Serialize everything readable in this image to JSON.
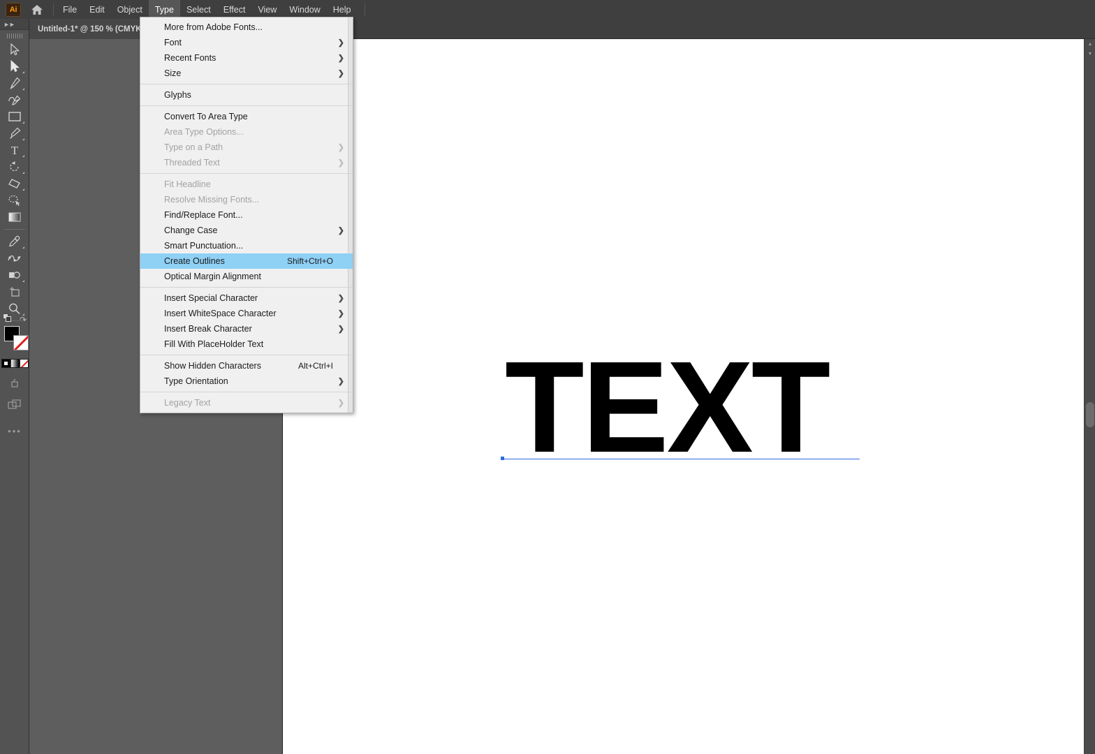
{
  "app": {
    "name": "Adobe Illustrator",
    "logo_text": "Ai",
    "home_icon": "home-icon"
  },
  "menubar": {
    "items": [
      {
        "label": "File",
        "active": false
      },
      {
        "label": "Edit",
        "active": false
      },
      {
        "label": "Object",
        "active": false
      },
      {
        "label": "Type",
        "active": true
      },
      {
        "label": "Select",
        "active": false
      },
      {
        "label": "Effect",
        "active": false
      },
      {
        "label": "View",
        "active": false
      },
      {
        "label": "Window",
        "active": false
      },
      {
        "label": "Help",
        "active": false
      }
    ]
  },
  "document": {
    "tab_label": "Untitled-1* @ 150 % (CMYK/",
    "zoom": "150 %",
    "color_mode": "CMYK",
    "modified": true
  },
  "toolbar": {
    "collapse_icon": "double-chevron-right-icon",
    "grip_icon": "panel-grip-icon",
    "tools": [
      {
        "name": "selection-tool",
        "icon": "arrow-cursor-icon",
        "selected": false,
        "has_flyout": false
      },
      {
        "name": "direct-selection-tool",
        "icon": "filled-arrow-cursor-icon",
        "selected": true,
        "has_flyout": true
      },
      {
        "name": "pen-tool",
        "icon": "pen-icon",
        "selected": false,
        "has_flyout": true
      },
      {
        "name": "curvature-tool",
        "icon": "curvature-icon",
        "selected": false,
        "has_flyout": false
      },
      {
        "name": "rectangle-tool",
        "icon": "rectangle-icon",
        "selected": false,
        "has_flyout": true
      },
      {
        "name": "paintbrush-tool",
        "icon": "paintbrush-icon",
        "selected": false,
        "has_flyout": true
      },
      {
        "name": "type-tool",
        "icon": "type-t-icon",
        "selected": false,
        "has_flyout": true
      },
      {
        "name": "rotate-tool",
        "icon": "rotate-icon",
        "selected": false,
        "has_flyout": true
      },
      {
        "name": "eraser-tool",
        "icon": "eraser-icon",
        "selected": false,
        "has_flyout": true
      },
      {
        "name": "lasso-tool",
        "icon": "lasso-icon",
        "selected": false,
        "has_flyout": false
      },
      {
        "name": "gradient-tool",
        "icon": "gradient-icon",
        "selected": false,
        "has_flyout": false
      },
      {
        "name": "eyedropper-tool",
        "icon": "eyedropper-icon",
        "selected": false,
        "has_flyout": true
      },
      {
        "name": "blend-tool",
        "icon": "blend-icon",
        "selected": false,
        "has_flyout": false
      },
      {
        "name": "shape-builder-tool",
        "icon": "shape-builder-icon",
        "selected": false,
        "has_flyout": true
      },
      {
        "name": "artboard-tool",
        "icon": "artboard-icon",
        "selected": false,
        "has_flyout": false
      },
      {
        "name": "zoom-tool",
        "icon": "magnifier-icon",
        "selected": false,
        "has_flyout": true
      }
    ],
    "fill_stroke": {
      "fill_color": "#000000",
      "stroke_color": "#ffffff",
      "stroke_none": true,
      "swap_icon": "swap-fill-stroke-icon",
      "default_icon": "default-fill-stroke-icon"
    },
    "color_modes": [
      {
        "name": "color-mode-solid",
        "icon": "solid-color-icon"
      },
      {
        "name": "color-mode-gradient",
        "icon": "gradient-swatch-icon"
      },
      {
        "name": "color-mode-none",
        "icon": "none-swatch-icon"
      }
    ],
    "draw_mode_icon": "draw-normal-icon",
    "screen_mode_icon": "screen-mode-icon",
    "edit_toolbar_label": "•••"
  },
  "type_menu": {
    "title": "Type",
    "sections": [
      {
        "items": [
          {
            "label": "More from Adobe Fonts...",
            "accel": "",
            "submenu": false,
            "disabled": false,
            "highlight": false
          },
          {
            "label": "Font",
            "accel": "",
            "submenu": true,
            "disabled": false,
            "highlight": false
          },
          {
            "label": "Recent Fonts",
            "accel": "",
            "submenu": true,
            "disabled": false,
            "highlight": false
          },
          {
            "label": "Size",
            "accel": "",
            "submenu": true,
            "disabled": false,
            "highlight": false
          }
        ]
      },
      {
        "items": [
          {
            "label": "Glyphs",
            "accel": "",
            "submenu": false,
            "disabled": false,
            "highlight": false
          }
        ]
      },
      {
        "items": [
          {
            "label": "Convert To Area Type",
            "accel": "",
            "submenu": false,
            "disabled": false,
            "highlight": false
          },
          {
            "label": "Area Type Options...",
            "accel": "",
            "submenu": false,
            "disabled": true,
            "highlight": false
          },
          {
            "label": "Type on a Path",
            "accel": "",
            "submenu": true,
            "disabled": true,
            "highlight": false
          },
          {
            "label": "Threaded Text",
            "accel": "",
            "submenu": true,
            "disabled": true,
            "highlight": false
          }
        ]
      },
      {
        "items": [
          {
            "label": "Fit Headline",
            "accel": "",
            "submenu": false,
            "disabled": true,
            "highlight": false
          },
          {
            "label": "Resolve Missing Fonts...",
            "accel": "",
            "submenu": false,
            "disabled": true,
            "highlight": false
          },
          {
            "label": "Find/Replace Font...",
            "accel": "",
            "submenu": false,
            "disabled": false,
            "highlight": false
          },
          {
            "label": "Change Case",
            "accel": "",
            "submenu": true,
            "disabled": false,
            "highlight": false
          },
          {
            "label": "Smart Punctuation...",
            "accel": "",
            "submenu": false,
            "disabled": false,
            "highlight": false
          },
          {
            "label": "Create Outlines",
            "accel": "Shift+Ctrl+O",
            "submenu": false,
            "disabled": false,
            "highlight": true
          },
          {
            "label": "Optical Margin Alignment",
            "accel": "",
            "submenu": false,
            "disabled": false,
            "highlight": false
          }
        ]
      },
      {
        "items": [
          {
            "label": "Insert Special Character",
            "accel": "",
            "submenu": true,
            "disabled": false,
            "highlight": false
          },
          {
            "label": "Insert WhiteSpace Character",
            "accel": "",
            "submenu": true,
            "disabled": false,
            "highlight": false
          },
          {
            "label": "Insert Break Character",
            "accel": "",
            "submenu": true,
            "disabled": false,
            "highlight": false
          },
          {
            "label": "Fill With PlaceHolder Text",
            "accel": "",
            "submenu": false,
            "disabled": false,
            "highlight": false
          }
        ]
      },
      {
        "items": [
          {
            "label": "Show Hidden Characters",
            "accel": "Alt+Ctrl+I",
            "submenu": false,
            "disabled": false,
            "highlight": false
          },
          {
            "label": "Type Orientation",
            "accel": "",
            "submenu": true,
            "disabled": false,
            "highlight": false
          }
        ]
      },
      {
        "items": [
          {
            "label": "Legacy Text",
            "accel": "",
            "submenu": true,
            "disabled": true,
            "highlight": false
          }
        ]
      }
    ]
  },
  "canvas": {
    "artwork_text": "TEXT",
    "artwork_color": "#000000",
    "selection_color": "#2a6ce0",
    "background_color": "#5e5e5e",
    "artboard_color": "#ffffff"
  },
  "scrollbar": {
    "up_arrow": "scroll-up-arrow-icon",
    "down_arrow": "scroll-down-arrow-icon"
  },
  "colors": {
    "chrome": "#3f3f3f",
    "panel": "#535353",
    "menu_bg": "#f0f0f0",
    "highlight": "#8fd0f5",
    "accent": "#ff9a00"
  }
}
